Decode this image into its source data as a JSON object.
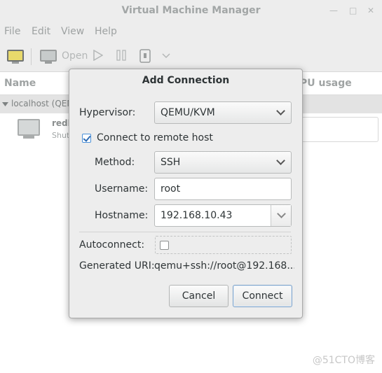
{
  "window": {
    "title": "Virtual Machine Manager",
    "controls": [
      "minimize-icon",
      "maximize-icon",
      "close-icon"
    ]
  },
  "menubar": {
    "items": [
      "File",
      "Edit",
      "View",
      "Help"
    ]
  },
  "toolbar": {
    "new_icon": "new-vm-icon",
    "open_label": "Open",
    "run_icon": "play-icon",
    "pause_icon": "pause-icon",
    "shutdown_icon": "power-icon",
    "menu_icon": "chevron-down-icon"
  },
  "vm_list": {
    "columns": [
      "Name",
      "PU usage"
    ],
    "group": "localhost (QEM",
    "vms": [
      {
        "name": "redh",
        "status": "Shut"
      }
    ]
  },
  "dialog": {
    "title": "Add Connection",
    "hypervisor_label": "Hypervisor:",
    "hypervisor_value": "QEMU/KVM",
    "remote_label": "Connect to remote host",
    "remote_checked": true,
    "method_label": "Method:",
    "method_value": "SSH",
    "username_label": "Username:",
    "username_value": "root",
    "hostname_label": "Hostname:",
    "hostname_value": "192.168.10.43",
    "autoconnect_label": "Autoconnect:",
    "autoconnect_checked": false,
    "uri_label": "Generated URI:",
    "uri_value": "qemu+ssh://root@192.168...",
    "cancel_label": "Cancel",
    "connect_label": "Connect"
  },
  "watermark": "@51CTO博客",
  "colors": {
    "dialog_bg": "#ededed",
    "check_accent": "#2d6cb5",
    "primary_border": "#7da2c9"
  }
}
